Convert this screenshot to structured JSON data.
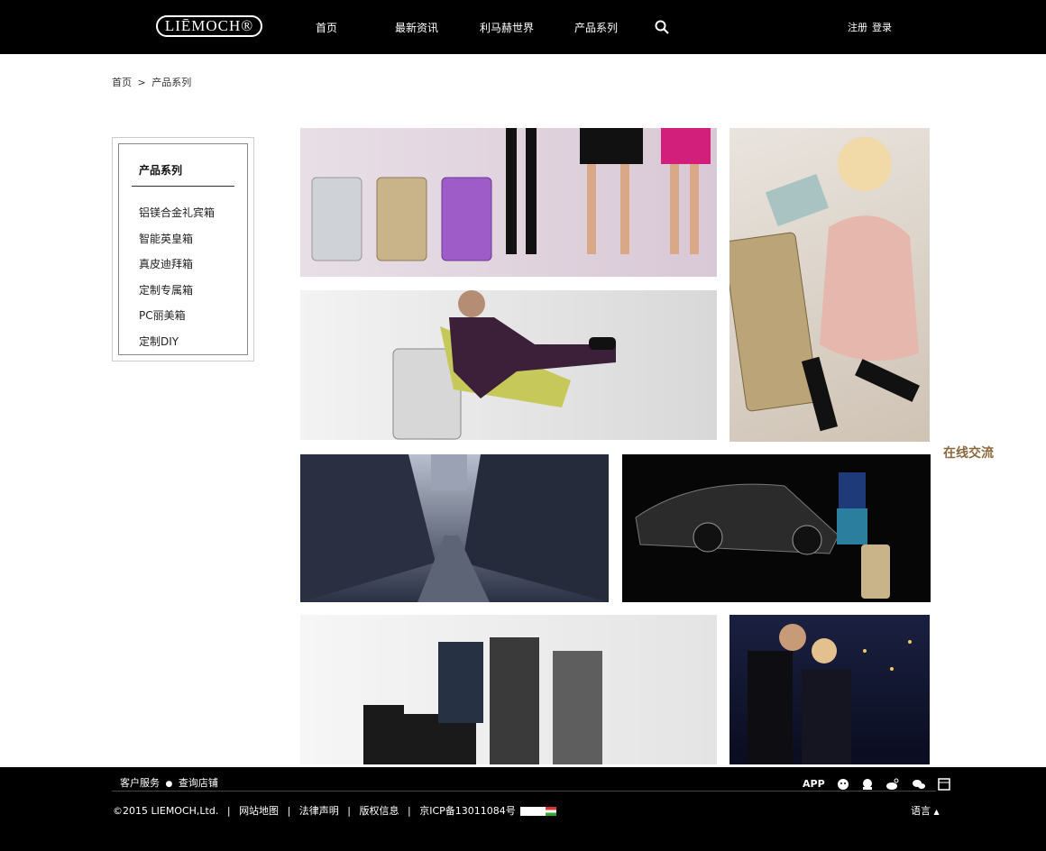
{
  "header": {
    "logo_text": "LIĒMOCH®",
    "nav": [
      "首页",
      "最新资讯",
      "利马赫世界",
      "产品系列"
    ],
    "register": "注册",
    "login": "登录"
  },
  "breadcrumb": {
    "home": "首页",
    "separator": ">",
    "current": "产品系列"
  },
  "sidebar": {
    "title": "产品系列",
    "items": [
      "铝镁合金礼宾箱",
      "智能英皇箱",
      "真皮迪拜箱",
      "定制专属箱",
      "PC丽美箱",
      "定制DIY"
    ]
  },
  "gallery": [
    {
      "name": "luggage-fashion-legs"
    },
    {
      "name": "woman-lying-with-case"
    },
    {
      "name": "man-in-chair-with-suitcase"
    },
    {
      "name": "european-city-street"
    },
    {
      "name": "supercar-model-suitcase"
    },
    {
      "name": "three-men-luggage"
    },
    {
      "name": "couple-night-city"
    }
  ],
  "float_chat": "在线交流",
  "footer": {
    "top_links": [
      "客户服务",
      "查询店铺"
    ],
    "bullet": "●",
    "copyright": "©2015 LIEMOCH,Ltd.",
    "links": [
      "网站地图",
      "法律声明",
      "版权信息",
      "京ICP备13011084号"
    ],
    "separator": "|",
    "app_label": "APP",
    "language": "语言"
  },
  "colors": {
    "header_bg": "#000000",
    "footer_bg": "#000000",
    "accent_chat": "#8a6a3c"
  }
}
